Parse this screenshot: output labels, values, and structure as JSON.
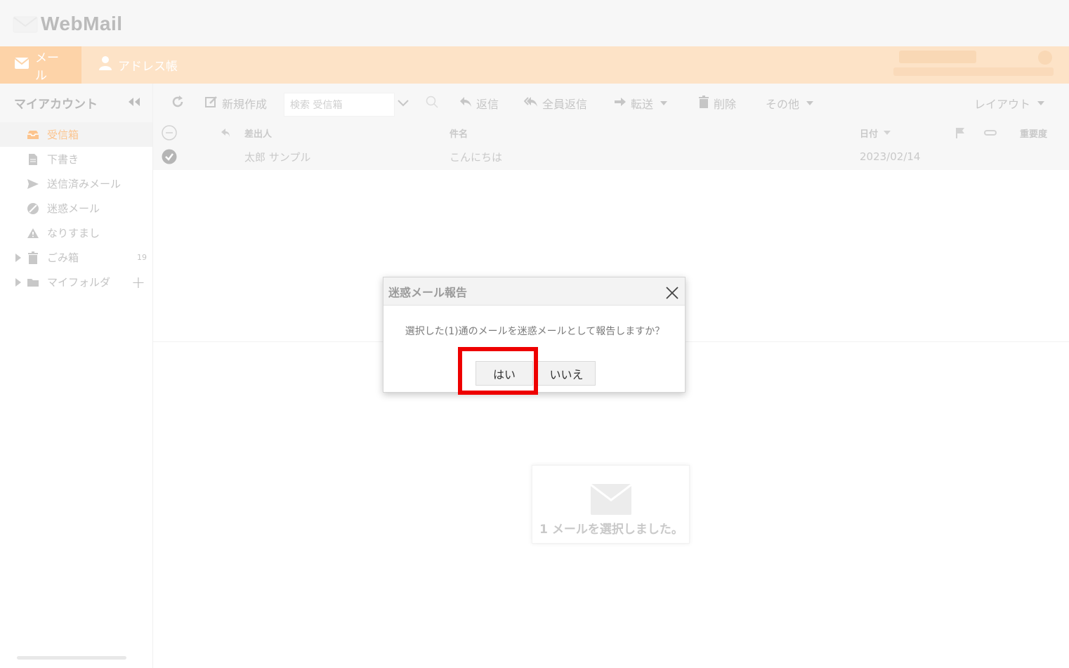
{
  "app": {
    "logo_text": "WebMail"
  },
  "topnav": {
    "mail_label": "メール",
    "address_label": "アドレス帳"
  },
  "sidebar": {
    "title": "マイアカウント",
    "folders": [
      {
        "label": "受信箱"
      },
      {
        "label": "下書き"
      },
      {
        "label": "送信済みメール"
      },
      {
        "label": "迷惑メール"
      },
      {
        "label": "なりすまし"
      },
      {
        "label": "ごみ箱",
        "count": "19"
      },
      {
        "label": "マイフォルダ"
      }
    ]
  },
  "toolbar": {
    "compose": "新規作成",
    "search_placeholder": "検索 受信箱",
    "reply": "返信",
    "reply_all": "全員返信",
    "forward": "転送",
    "delete": "削除",
    "other": "その他",
    "layout": "レイアウト"
  },
  "list": {
    "headers": {
      "from": "差出人",
      "subject": "件名",
      "date": "日付",
      "importance": "重要度"
    },
    "rows": [
      {
        "from": "太郎 サンプル",
        "subject": "こんにちは",
        "date": "2023/02/14"
      }
    ]
  },
  "preview": {
    "message": "1 メールを選択しました。"
  },
  "dialog": {
    "title": "迷惑メール報告",
    "message": "選択した(1)通のメールを迷惑メールとして報告しますか？",
    "yes": "はい",
    "no": "いいえ"
  },
  "colors": {
    "accent": "#fdd3a8",
    "highlight": "#ee0000"
  }
}
